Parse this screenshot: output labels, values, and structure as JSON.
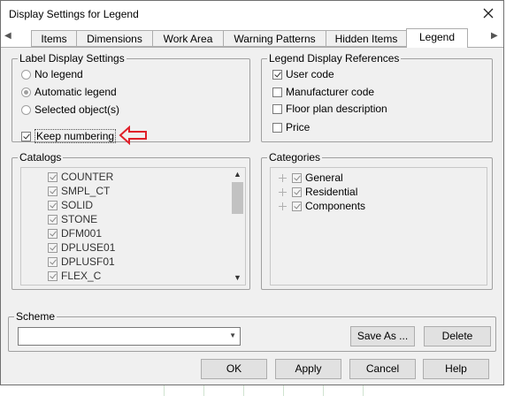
{
  "window": {
    "title": "Display Settings for Legend"
  },
  "tabs": [
    {
      "label": "Items",
      "active": false
    },
    {
      "label": "Dimensions",
      "active": false
    },
    {
      "label": "Work Area",
      "active": false
    },
    {
      "label": "Warning Patterns",
      "active": false
    },
    {
      "label": "Hidden Items",
      "active": false
    },
    {
      "label": "Legend",
      "active": true
    }
  ],
  "label_display": {
    "title": "Label Display Settings",
    "options": [
      {
        "label": "No legend",
        "selected": false
      },
      {
        "label": "Automatic legend",
        "selected": true
      },
      {
        "label": "Selected object(s)",
        "selected": false
      }
    ],
    "keep_numbering": {
      "label": "Keep numbering",
      "checked": true
    }
  },
  "legend_refs": {
    "title": "Legend Display References",
    "items": [
      {
        "label": "User code",
        "checked": true
      },
      {
        "label": "Manufacturer code",
        "checked": false
      },
      {
        "label": "Floor plan description",
        "checked": false
      },
      {
        "label": "Price",
        "checked": false
      }
    ]
  },
  "catalogs": {
    "title": "Catalogs",
    "items": [
      "COUNTER",
      "SMPL_CT",
      "SOLID",
      "STONE",
      "DFM001",
      "DPLUSE01",
      "DPLUSF01",
      "FLEX_C"
    ]
  },
  "categories": {
    "title": "Categories",
    "items": [
      "General",
      "Residential",
      "Components"
    ]
  },
  "scheme": {
    "title": "Scheme",
    "value": "",
    "save_as": "Save As ...",
    "delete": "Delete"
  },
  "footer": {
    "ok": "OK",
    "apply": "Apply",
    "cancel": "Cancel",
    "help": "Help"
  },
  "colors": {
    "callout_arrow": "#e0202a"
  }
}
